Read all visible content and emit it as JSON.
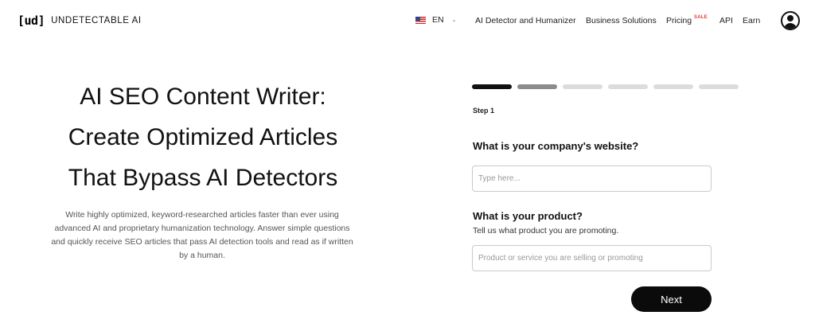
{
  "header": {
    "logo_mark": "[ud]",
    "logo_text": "UNDETECTABLE AI",
    "language": "EN",
    "nav": [
      "AI Detector and Humanizer",
      "Business Solutions",
      "Pricing",
      "API",
      "Earn"
    ],
    "sale_badge": "SALE",
    "icons": {
      "flag": "us-flag-icon",
      "chevron": "chevron-down-icon",
      "account": "user-avatar-icon"
    }
  },
  "hero": {
    "title_lines": [
      "AI SEO Content Writer:",
      "Create Optimized Articles",
      "That Bypass AI Detectors"
    ],
    "description": "Write highly optimized, keyword-researched articles faster than ever using advanced AI and proprietary humanization technology. Answer simple questions and quickly receive SEO articles that pass AI detection tools and read as if written by a human."
  },
  "form": {
    "progress": {
      "total_steps": 6,
      "current_step": 1
    },
    "step_label": "Step 1",
    "q1": {
      "label": "What is your company's website?",
      "placeholder": "Type here...",
      "value": ""
    },
    "q2": {
      "label": "What is your product?",
      "hint": "Tell us what product you are promoting.",
      "placeholder": "Product or service you are selling or promoting",
      "value": ""
    },
    "next_label": "Next"
  },
  "colors": {
    "primary": "#0b0b0b",
    "sale": "#e53935",
    "progress_active": "#111111",
    "progress_next": "#8c8c8c",
    "progress_inactive": "#dcdcdc"
  }
}
